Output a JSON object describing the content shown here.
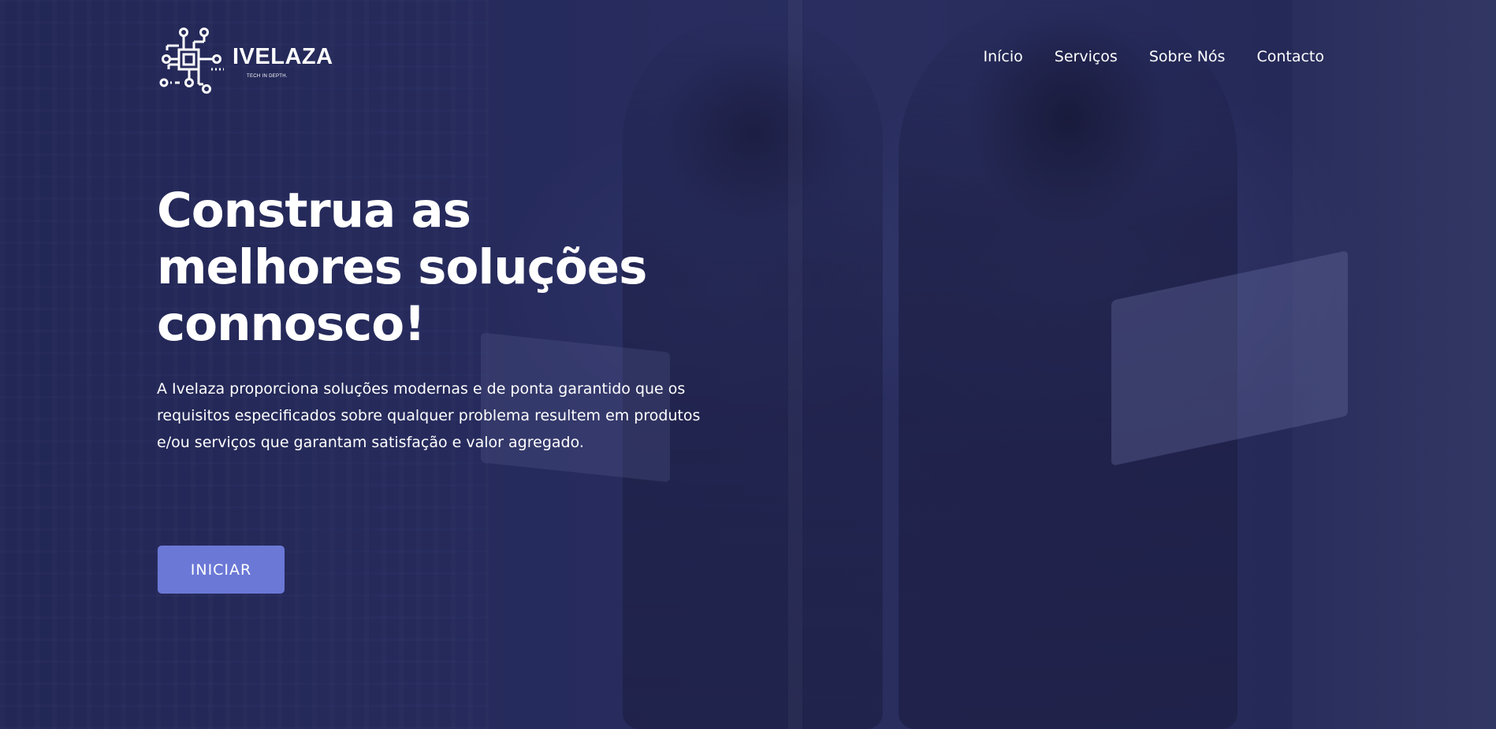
{
  "brand": {
    "name": "IVELAZA",
    "tagline": "TECH IN DEPTH.",
    "logo_icon": "circuit-chip-icon",
    "color": "#ffffff"
  },
  "nav": {
    "items": [
      {
        "label": "Início"
      },
      {
        "label": "Serviços"
      },
      {
        "label": "Sobre Nós"
      },
      {
        "label": "Contacto"
      }
    ]
  },
  "hero": {
    "headline_lines": [
      "Construa as",
      "melhores soluções",
      "connosco!"
    ],
    "description": "A Ivelaza proporciona soluções modernas e de ponta garantido que os requisitos especificados sobre qualquer problema resultem em produtos e/ou serviços que garantam satisfação e valor agregado.",
    "cta_label": "INICIAR"
  },
  "colors": {
    "background": "#2c3064",
    "accent_button": "#6b78d6",
    "text": "#ffffff"
  }
}
